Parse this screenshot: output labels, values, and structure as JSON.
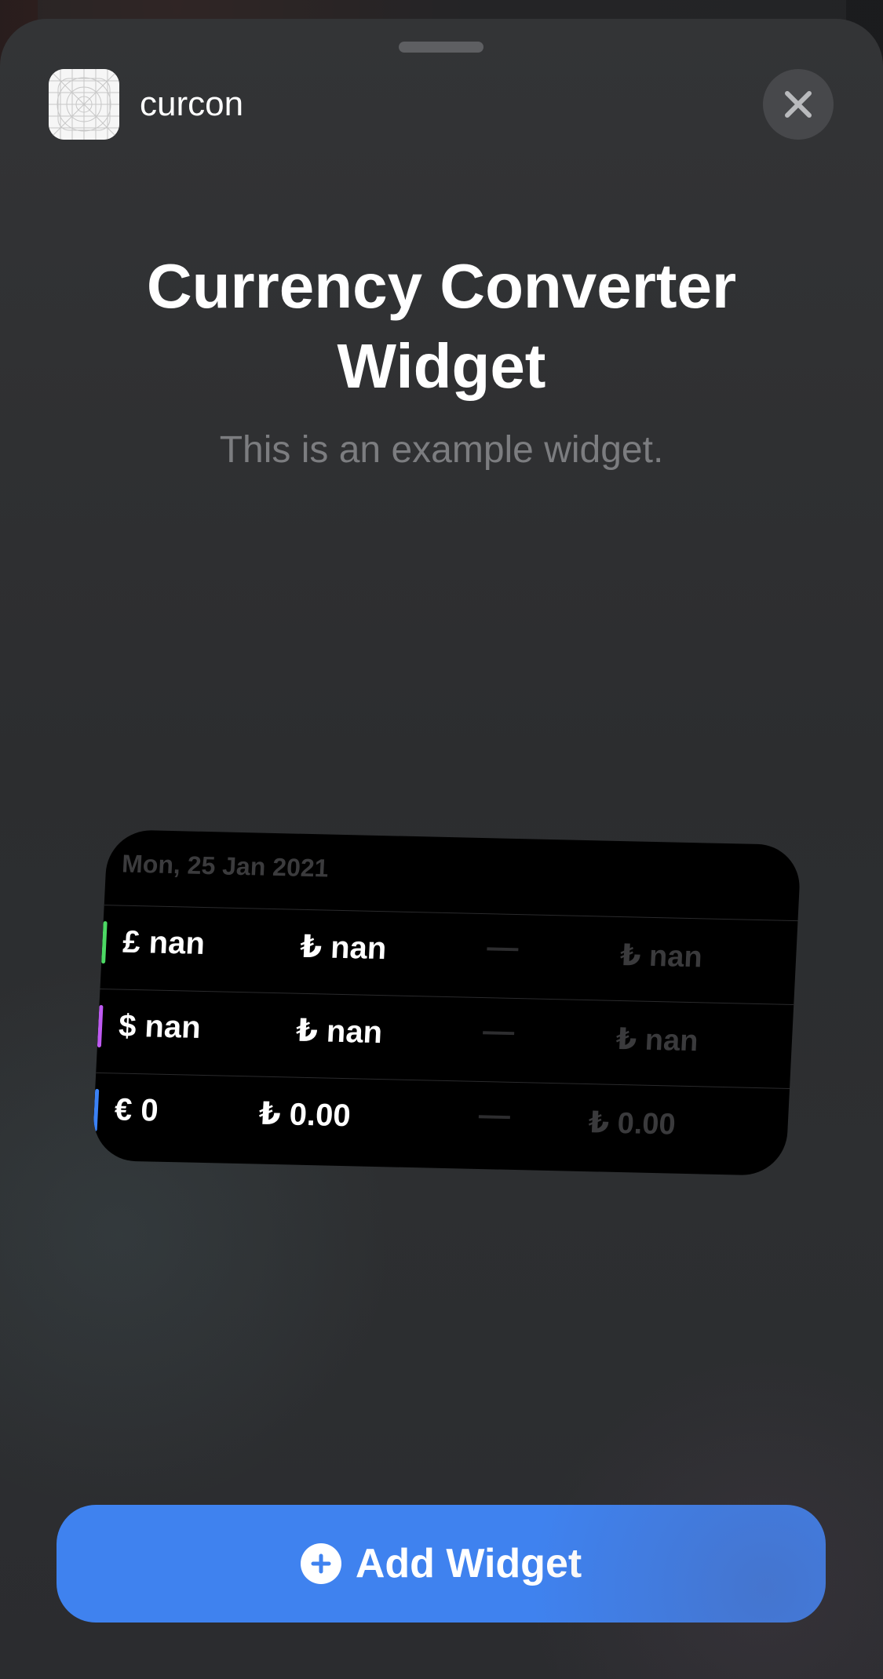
{
  "header": {
    "app_name": "curcon",
    "app_icon": "app-grid-icon",
    "close_icon": "close-icon"
  },
  "content": {
    "title_line1": "Currency Converter",
    "title_line2": "Widget",
    "subtitle": "This is an example widget."
  },
  "widget": {
    "date": "Mon, 25 Jan 2021",
    "rows": [
      {
        "accent": "#4cd964",
        "from": "£ nan",
        "to": "₺ nan",
        "dash": "—",
        "rate": "₺ nan"
      },
      {
        "accent": "#bf5af2",
        "from": "$ nan",
        "to": "₺ nan",
        "dash": "—",
        "rate": "₺ nan"
      },
      {
        "accent": "#3b82f6",
        "from": "€ 0",
        "to": "₺ 0.00",
        "dash": "—",
        "rate": "₺ 0.00"
      }
    ]
  },
  "footer": {
    "add_label": "Add Widget",
    "add_icon": "plus-circle-icon"
  },
  "colors": {
    "accent_blue": "#3f82ef",
    "sheet_bg": "#2e2f31"
  }
}
